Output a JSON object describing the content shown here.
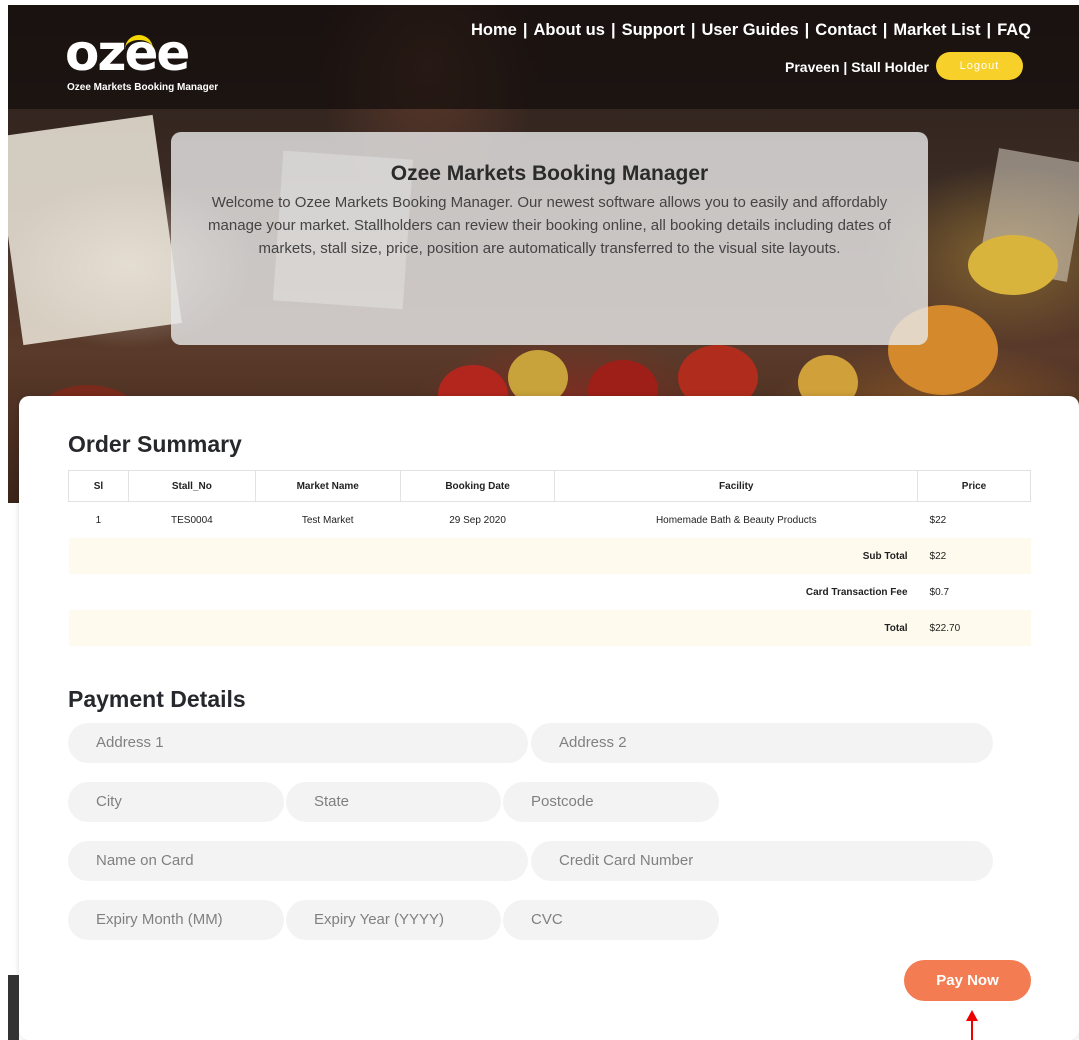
{
  "header": {
    "logo_text": "ozee",
    "logo_subtitle": "Ozee Markets Booking Manager",
    "nav": [
      "Home",
      "About us",
      "Support",
      "User Guides",
      "Contact",
      "Market List",
      "FAQ"
    ],
    "user_name": "Praveen",
    "user_role": "Stall Holder",
    "logout_label": "Logout"
  },
  "welcome": {
    "title": "Ozee Markets Booking Manager",
    "body": "Welcome to Ozee Markets Booking Manager. Our newest software allows you to easily and affordably manage your market. Stallholders can review their booking online, all booking details including dates of markets, stall size, price, position are automatically transferred to the visual site layouts."
  },
  "order_summary": {
    "title": "Order Summary",
    "columns": [
      "Sl",
      "Stall_No",
      "Market Name",
      "Booking Date",
      "Facility",
      "Price"
    ],
    "rows": [
      {
        "sl": "1",
        "stall_no": "TES0004",
        "market": "Test Market",
        "date": "29 Sep 2020",
        "facility": "Homemade Bath & Beauty Products",
        "price": "$22"
      }
    ],
    "subtotal_label": "Sub Total",
    "subtotal": "$22",
    "fee_label": "Card Transaction Fee",
    "fee": "$0.7",
    "total_label": "Total",
    "total": "$22.70"
  },
  "payment": {
    "title": "Payment Details",
    "address1": "Address 1",
    "address2": "Address 2",
    "city": "City",
    "state": "State",
    "postcode": "Postcode",
    "name_on_card": "Name on Card",
    "card_number": "Credit Card Number",
    "expiry_month": "Expiry Month (MM)",
    "expiry_year": "Expiry Year (YYYY)",
    "cvc": "CVC",
    "pay_label": "Pay Now"
  },
  "colors": {
    "accent_yellow": "#f7d02a",
    "pay_orange": "#f37c52",
    "annotation_red": "#e00000"
  }
}
